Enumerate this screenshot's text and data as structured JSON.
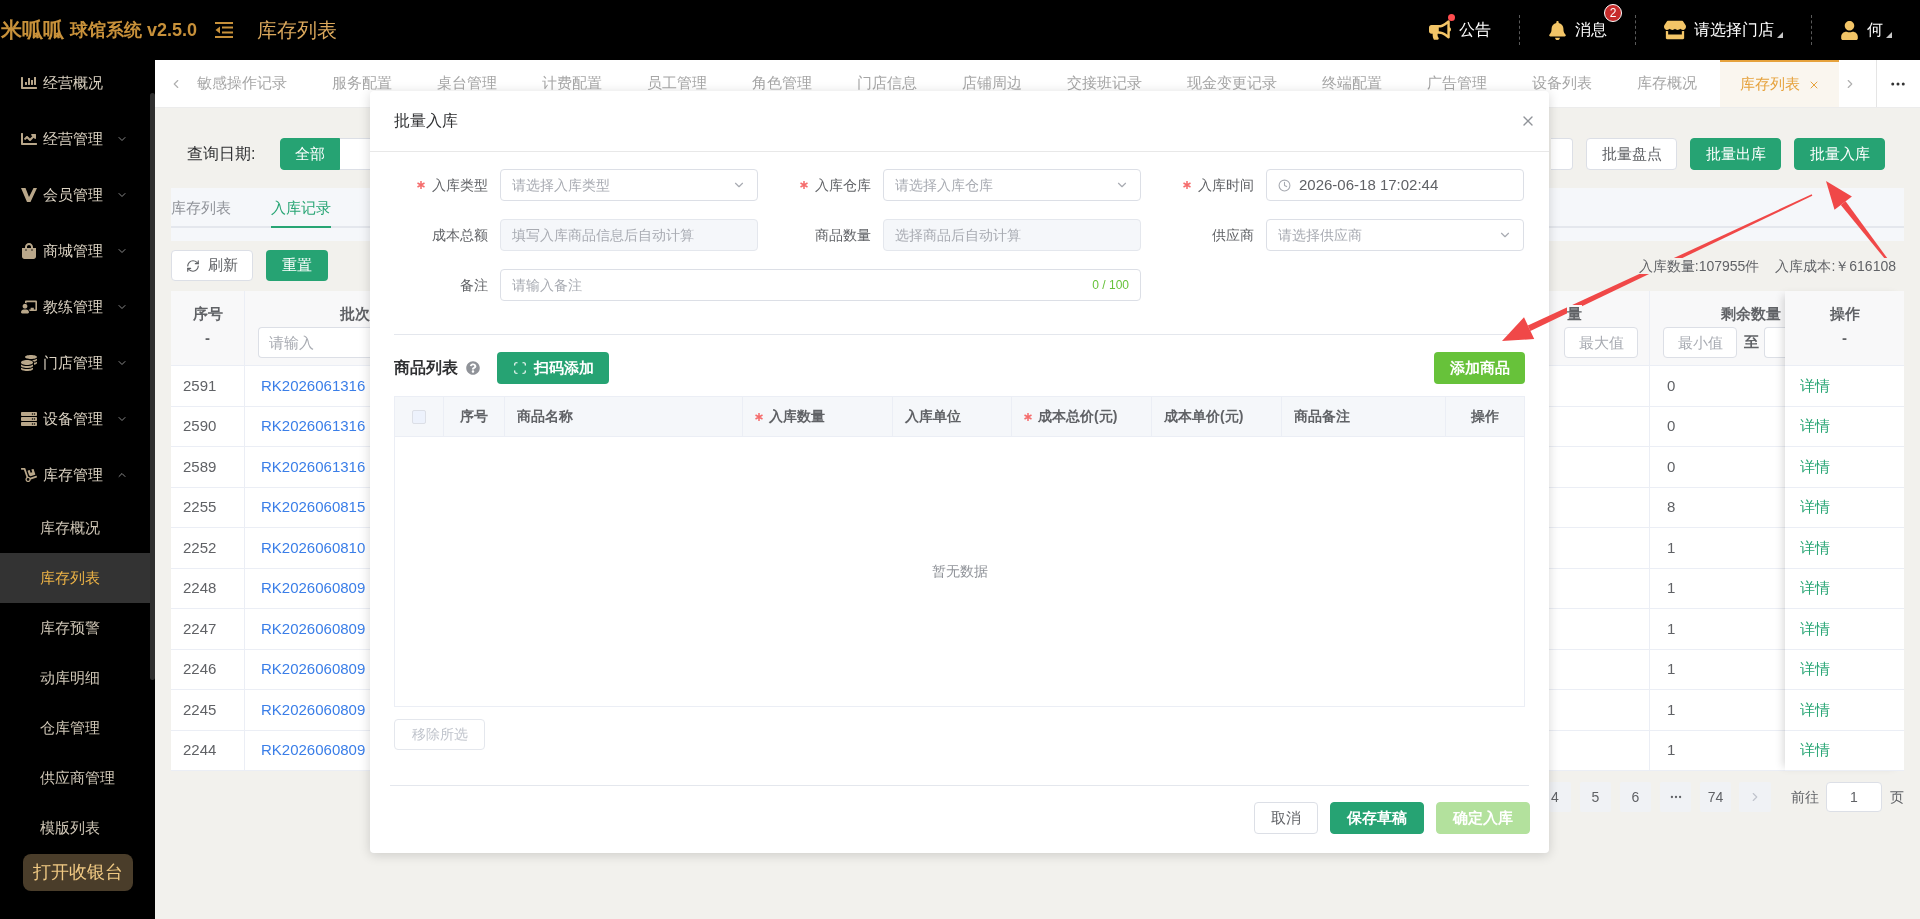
{
  "header": {
    "logo": "米呱呱",
    "app_name": "球馆系统 v2.5.0",
    "page_title": "库存列表",
    "actions": [
      {
        "kind": "notice",
        "label": "公告",
        "unread": true,
        "caret": false
      },
      {
        "kind": "message",
        "label": "消息",
        "badge": "2",
        "unread": false,
        "caret": false
      },
      {
        "kind": "store",
        "label": "请选择门店",
        "unread": false,
        "caret": true
      },
      {
        "kind": "user",
        "label": "何",
        "unread": false,
        "caret": true
      }
    ]
  },
  "sidebar": {
    "items": [
      {
        "label": "经营概况"
      },
      {
        "label": "经营管理",
        "expanded": false
      },
      {
        "label": "会员管理",
        "expanded": false
      },
      {
        "label": "商城管理",
        "expanded": false
      },
      {
        "label": "教练管理",
        "expanded": false
      },
      {
        "label": "门店管理",
        "expanded": false
      },
      {
        "label": "设备管理",
        "expanded": false
      },
      {
        "label": "库存管理",
        "expanded": true,
        "children": [
          {
            "label": "库存概况",
            "selected": false
          },
          {
            "label": "库存列表",
            "selected": true
          },
          {
            "label": "库存预警",
            "selected": false
          },
          {
            "label": "动库明细",
            "selected": false
          },
          {
            "label": "仓库管理",
            "selected": false
          },
          {
            "label": "供应商管理",
            "selected": false
          },
          {
            "label": "模版列表",
            "selected": false
          }
        ]
      }
    ],
    "cashier_button": "打开收银台"
  },
  "tabs": [
    {
      "label": "敏感操作记录",
      "selected": false
    },
    {
      "label": "服务配置",
      "selected": false
    },
    {
      "label": "桌台管理",
      "selected": false
    },
    {
      "label": "计费配置",
      "selected": false
    },
    {
      "label": "员工管理",
      "selected": false
    },
    {
      "label": "角色管理",
      "selected": false
    },
    {
      "label": "门店信息",
      "selected": false
    },
    {
      "label": "店铺周边",
      "selected": false
    },
    {
      "label": "交接班记录",
      "selected": false
    },
    {
      "label": "现金变更记录",
      "selected": false
    },
    {
      "label": "终端配置",
      "selected": false
    },
    {
      "label": "广告管理",
      "selected": false
    },
    {
      "label": "设备列表",
      "selected": false
    },
    {
      "label": "库存概况",
      "selected": false
    },
    {
      "label": "库存列表",
      "selected": true
    }
  ],
  "filter": {
    "label": "查询日期:",
    "options": [
      {
        "label": "全部",
        "selected": true
      }
    ]
  },
  "toolbar": [
    {
      "kind": "default",
      "label": "批量盘点"
    },
    {
      "kind": "primary",
      "label": "批量出库"
    },
    {
      "kind": "primary",
      "label": "批量入库"
    }
  ],
  "record_tabs": [
    {
      "label": "库存列表",
      "selected": false
    },
    {
      "label": "入库记录",
      "selected": true
    }
  ],
  "actions": [
    {
      "kind": "refresh",
      "label": "刷新"
    },
    {
      "kind": "primary",
      "label": "重置"
    }
  ],
  "summary": [
    "入库数量:107955件",
    "入库成本:￥616108"
  ],
  "table": {
    "columns": [
      {
        "title": "序号",
        "filter": "-"
      },
      {
        "title": "批次",
        "placeholder": "请输入"
      },
      {
        "title": "量",
        "max_placeholder": "最大值"
      },
      {
        "title": "剩余数量",
        "min_placeholder": "最小值",
        "range_separator": "至"
      },
      {
        "title": "操作",
        "filter": "-"
      }
    ],
    "rows": [
      {
        "no": "2591",
        "batch": "RK2026061316",
        "remaining": "0",
        "action": "详情"
      },
      {
        "no": "2590",
        "batch": "RK2026061316",
        "remaining": "0",
        "action": "详情"
      },
      {
        "no": "2589",
        "batch": "RK2026061316",
        "remaining": "0",
        "action": "详情"
      },
      {
        "no": "2255",
        "batch": "RK2026060815",
        "remaining": "8",
        "action": "详情"
      },
      {
        "no": "2252",
        "batch": "RK2026060810",
        "remaining": "1",
        "action": "详情"
      },
      {
        "no": "2248",
        "batch": "RK2026060809",
        "remaining": "1",
        "action": "详情"
      },
      {
        "no": "2247",
        "batch": "RK2026060809",
        "remaining": "1",
        "action": "详情"
      },
      {
        "no": "2246",
        "batch": "RK2026060809",
        "remaining": "1",
        "action": "详情"
      },
      {
        "no": "2245",
        "batch": "RK2026060809",
        "remaining": "1",
        "action": "详情"
      },
      {
        "no": "2244",
        "batch": "RK2026060809",
        "remaining": "1",
        "action": "详情"
      }
    ]
  },
  "pagination": {
    "pages": [
      {
        "label": "4",
        "selected": false
      },
      {
        "label": "5",
        "selected": false
      },
      {
        "label": "6",
        "selected": false
      },
      {
        "label": "74",
        "selected": false
      }
    ],
    "goto_label": "前往",
    "goto_value": "1",
    "page_suffix": "页"
  },
  "dialog": {
    "title": "批量入库",
    "fields": [
      {
        "kind": "select",
        "label": "入库类型",
        "required": true,
        "placeholder": "请选择入库类型"
      },
      {
        "kind": "select",
        "label": "入库仓库",
        "required": true,
        "placeholder": "请选择入库仓库"
      },
      {
        "kind": "datetime",
        "label": "入库时间",
        "required": true,
        "value": "2026-06-18 17:02:44"
      },
      {
        "kind": "computed",
        "label": "成本总额",
        "required": false,
        "placeholder": "填写入库商品信息后自动计算"
      },
      {
        "kind": "computed",
        "label": "商品数量",
        "required": false,
        "placeholder": "选择商品后自动计算"
      },
      {
        "kind": "select",
        "label": "供应商",
        "required": false,
        "placeholder": "请选择供应商"
      },
      {
        "kind": "note",
        "label": "备注",
        "required": false,
        "placeholder": "请输入备注",
        "counter": "0 / 100"
      }
    ],
    "goods": {
      "title": "商品列表",
      "scan_button": "扫码添加",
      "add_button": "添加商品",
      "select_all": {
        "checked": false
      },
      "columns": [
        {
          "label": "序号",
          "required": false
        },
        {
          "label": "商品名称",
          "required": false
        },
        {
          "label": "入库数量",
          "required": true
        },
        {
          "label": "入库单位",
          "required": false
        },
        {
          "label": "成本总价(元)",
          "required": true
        },
        {
          "label": "成本单价(元)",
          "required": false
        },
        {
          "label": "商品备注",
          "required": false
        },
        {
          "label": "操作",
          "required": false
        }
      ],
      "empty_text": "暂无数据",
      "remove_button": {
        "label": "移除所选",
        "disabled": true
      }
    },
    "buttons": [
      {
        "kind": "default",
        "label": "取消",
        "disabled": false
      },
      {
        "kind": "primary",
        "label": "保存草稿",
        "disabled": false
      },
      {
        "kind": "success",
        "label": "确定入库",
        "disabled": true
      }
    ]
  }
}
